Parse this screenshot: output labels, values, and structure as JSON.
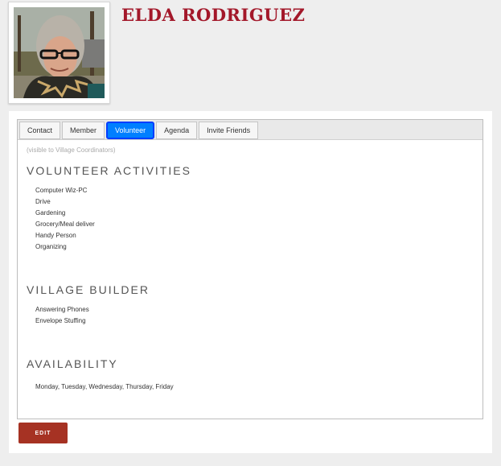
{
  "profile": {
    "name": "ELDA RODRIGUEZ"
  },
  "tabs": [
    {
      "label": "Contact",
      "active": false
    },
    {
      "label": "Member",
      "active": false
    },
    {
      "label": "Volunteer",
      "active": true
    },
    {
      "label": "Agenda",
      "active": false
    },
    {
      "label": "Invite Friends",
      "active": false
    }
  ],
  "volunteer": {
    "visibility_note": "(visible to Village Coordinators)",
    "activities": {
      "title": "VOLUNTEER ACTIVITIES",
      "items": [
        "Computer Wiz-PC",
        "Drive",
        "Gardening",
        "Grocery/Meal deliver",
        "Handy Person",
        "Organizing"
      ]
    },
    "village_builder": {
      "title": "VILLAGE BUILDER",
      "items": [
        "Answering Phones",
        "Envelope Stuffing"
      ]
    },
    "availability": {
      "title": "AVAILABILITY",
      "text": "Monday, Tuesday, Wednesday, Thursday, Friday"
    }
  },
  "actions": {
    "edit_label": "EDIT"
  },
  "colors": {
    "name": "#a3182a",
    "active_tab": "#007fff",
    "edit_button": "#a63223"
  }
}
